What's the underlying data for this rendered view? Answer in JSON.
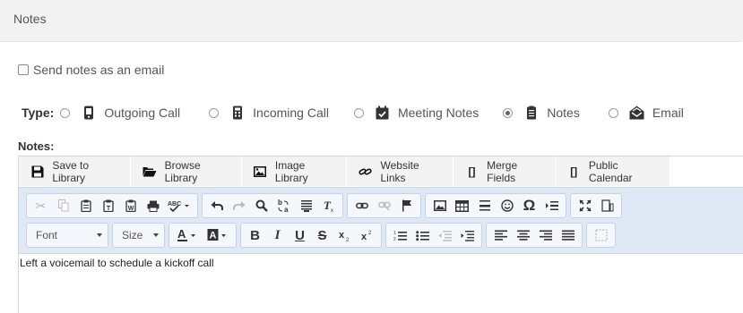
{
  "panel": {
    "title": "Notes"
  },
  "send_email": {
    "label": "Send notes as an email",
    "checked": false
  },
  "type": {
    "label": "Type:",
    "options": [
      {
        "label": "Outgoing Call",
        "icon": "mobile-phone-icon",
        "checked": false
      },
      {
        "label": "Incoming Call",
        "icon": "calculator-phone-icon",
        "checked": false
      },
      {
        "label": "Meeting Notes",
        "icon": "calendar-check-icon",
        "checked": false
      },
      {
        "label": "Notes",
        "icon": "notepad-icon",
        "checked": true
      },
      {
        "label": "Email",
        "icon": "email-envelope-icon",
        "checked": false
      }
    ]
  },
  "notes": {
    "label": "Notes:",
    "library_buttons": [
      {
        "label": "Save to Library",
        "icon": "floppy-disk-icon"
      },
      {
        "label": "Browse Library",
        "icon": "open-folder-icon"
      },
      {
        "label": "Image Library",
        "icon": "image-icon"
      },
      {
        "label": "Website Links",
        "icon": "link-icon"
      },
      {
        "label": "Merge Fields",
        "icon": "brackets-icon",
        "glyph": "[]"
      },
      {
        "label": "Public Calendar",
        "icon": "brackets-icon",
        "glyph": "[]"
      }
    ],
    "font_combo": "Font",
    "size_combo": "Size",
    "content": "Left a voicemail to schedule a kickoff call"
  }
}
